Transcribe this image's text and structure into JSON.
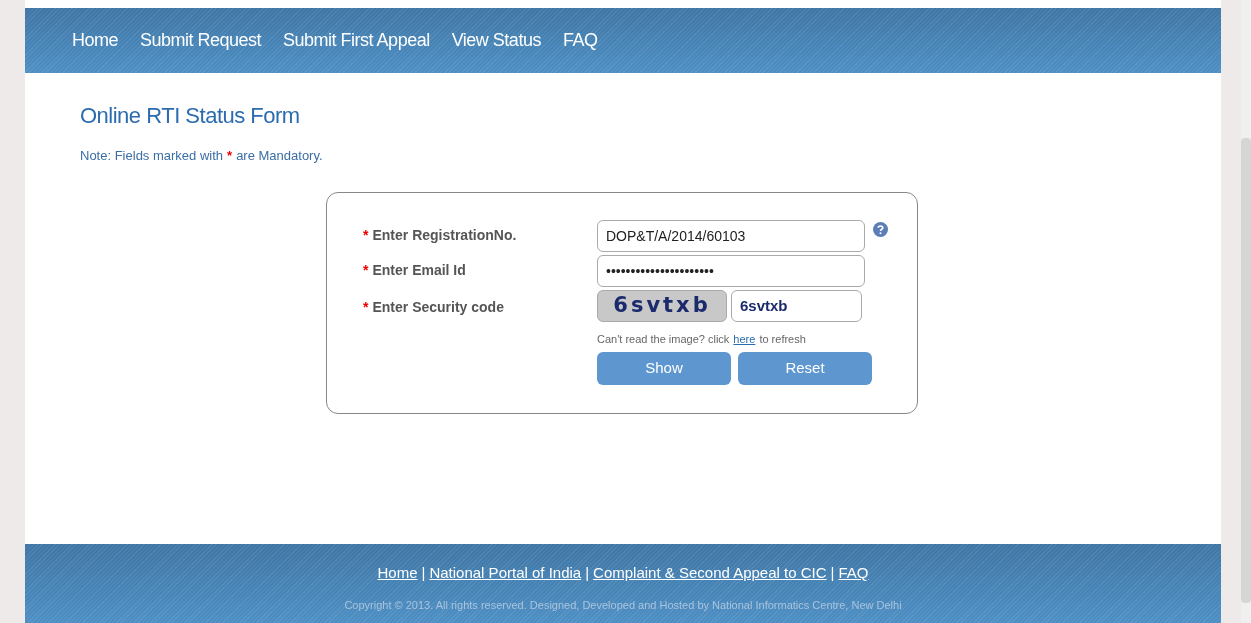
{
  "nav": [
    {
      "label": "Home"
    },
    {
      "label": "Submit Request"
    },
    {
      "label": "Submit First Appeal"
    },
    {
      "label": "View Status"
    },
    {
      "label": "FAQ"
    }
  ],
  "title": "Online RTI Status Form",
  "note": {
    "before": "Note: Fields marked with",
    "mark": "*",
    "after": "are Mandatory."
  },
  "form": {
    "fields": [
      {
        "kind": "text",
        "required": true,
        "label": "Enter RegistrationNo.",
        "value": "DOP&T/A/2014/60103",
        "help": true
      },
      {
        "kind": "text",
        "required": true,
        "label": "Enter Email Id",
        "value": "••••••••••••••••••••••",
        "help": false
      },
      {
        "kind": "captcha",
        "required": true,
        "label": "Enter Security code",
        "captcha": "6svtxb",
        "value": "6svtxb",
        "help": false
      }
    ],
    "refresh": {
      "before": "Can't read the image? click",
      "link": "here",
      "after": "to refresh"
    },
    "buttons": [
      "Show",
      "Reset"
    ]
  },
  "footer": {
    "links": [
      "Home",
      "National Portal of India",
      "Complaint & Second Appeal to CIC",
      "FAQ"
    ],
    "separator": "|",
    "copyright": "Copyright © 2013. All rights reserved. Designed, Developed and Hosted by National Informatics Centre, New Delhi"
  }
}
